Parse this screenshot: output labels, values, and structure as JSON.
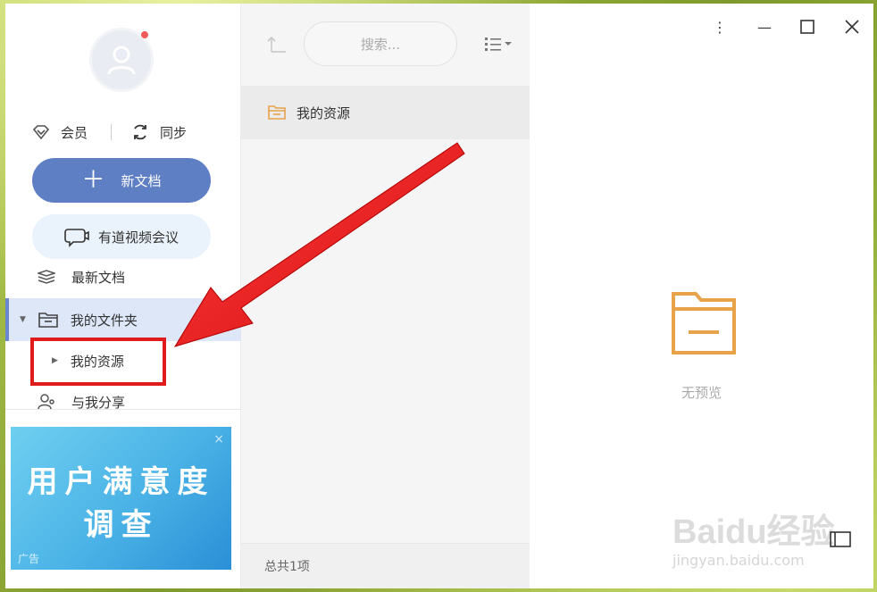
{
  "sidebar": {
    "vip_label": "会员",
    "sync_label": "同步",
    "new_doc_label": "新文档",
    "meeting_label": "有道视频会议",
    "nav": {
      "recent": "最新文档",
      "my_folder": "我的文件夹",
      "my_resource": "我的资源",
      "shared": "与我分享"
    },
    "ad": {
      "line1": "用户满意度",
      "line2": "调查",
      "label": "广告",
      "close": "×"
    }
  },
  "list": {
    "search_placeholder": "搜索...",
    "items": [
      {
        "name": "我的资源"
      }
    ],
    "footer": "总共1项"
  },
  "preview": {
    "empty_text": "无预览",
    "watermark": "Baidu经验",
    "watermark_sub": "jingyan.baidu.com"
  },
  "colors": {
    "accent": "#5f7fc4",
    "folder": "#e8a24a",
    "annotation": "#e01b1b",
    "selection": "#dde7f8"
  },
  "icons": [
    "avatar-icon",
    "diamond-icon",
    "sync-icon",
    "plus-icon",
    "video-meeting-icon",
    "layers-icon",
    "folder-icon",
    "share-icon",
    "up-folder-icon",
    "list-view-icon",
    "more-icon",
    "minimize-icon",
    "maximize-icon",
    "close-icon",
    "panel-toggle-icon"
  ]
}
